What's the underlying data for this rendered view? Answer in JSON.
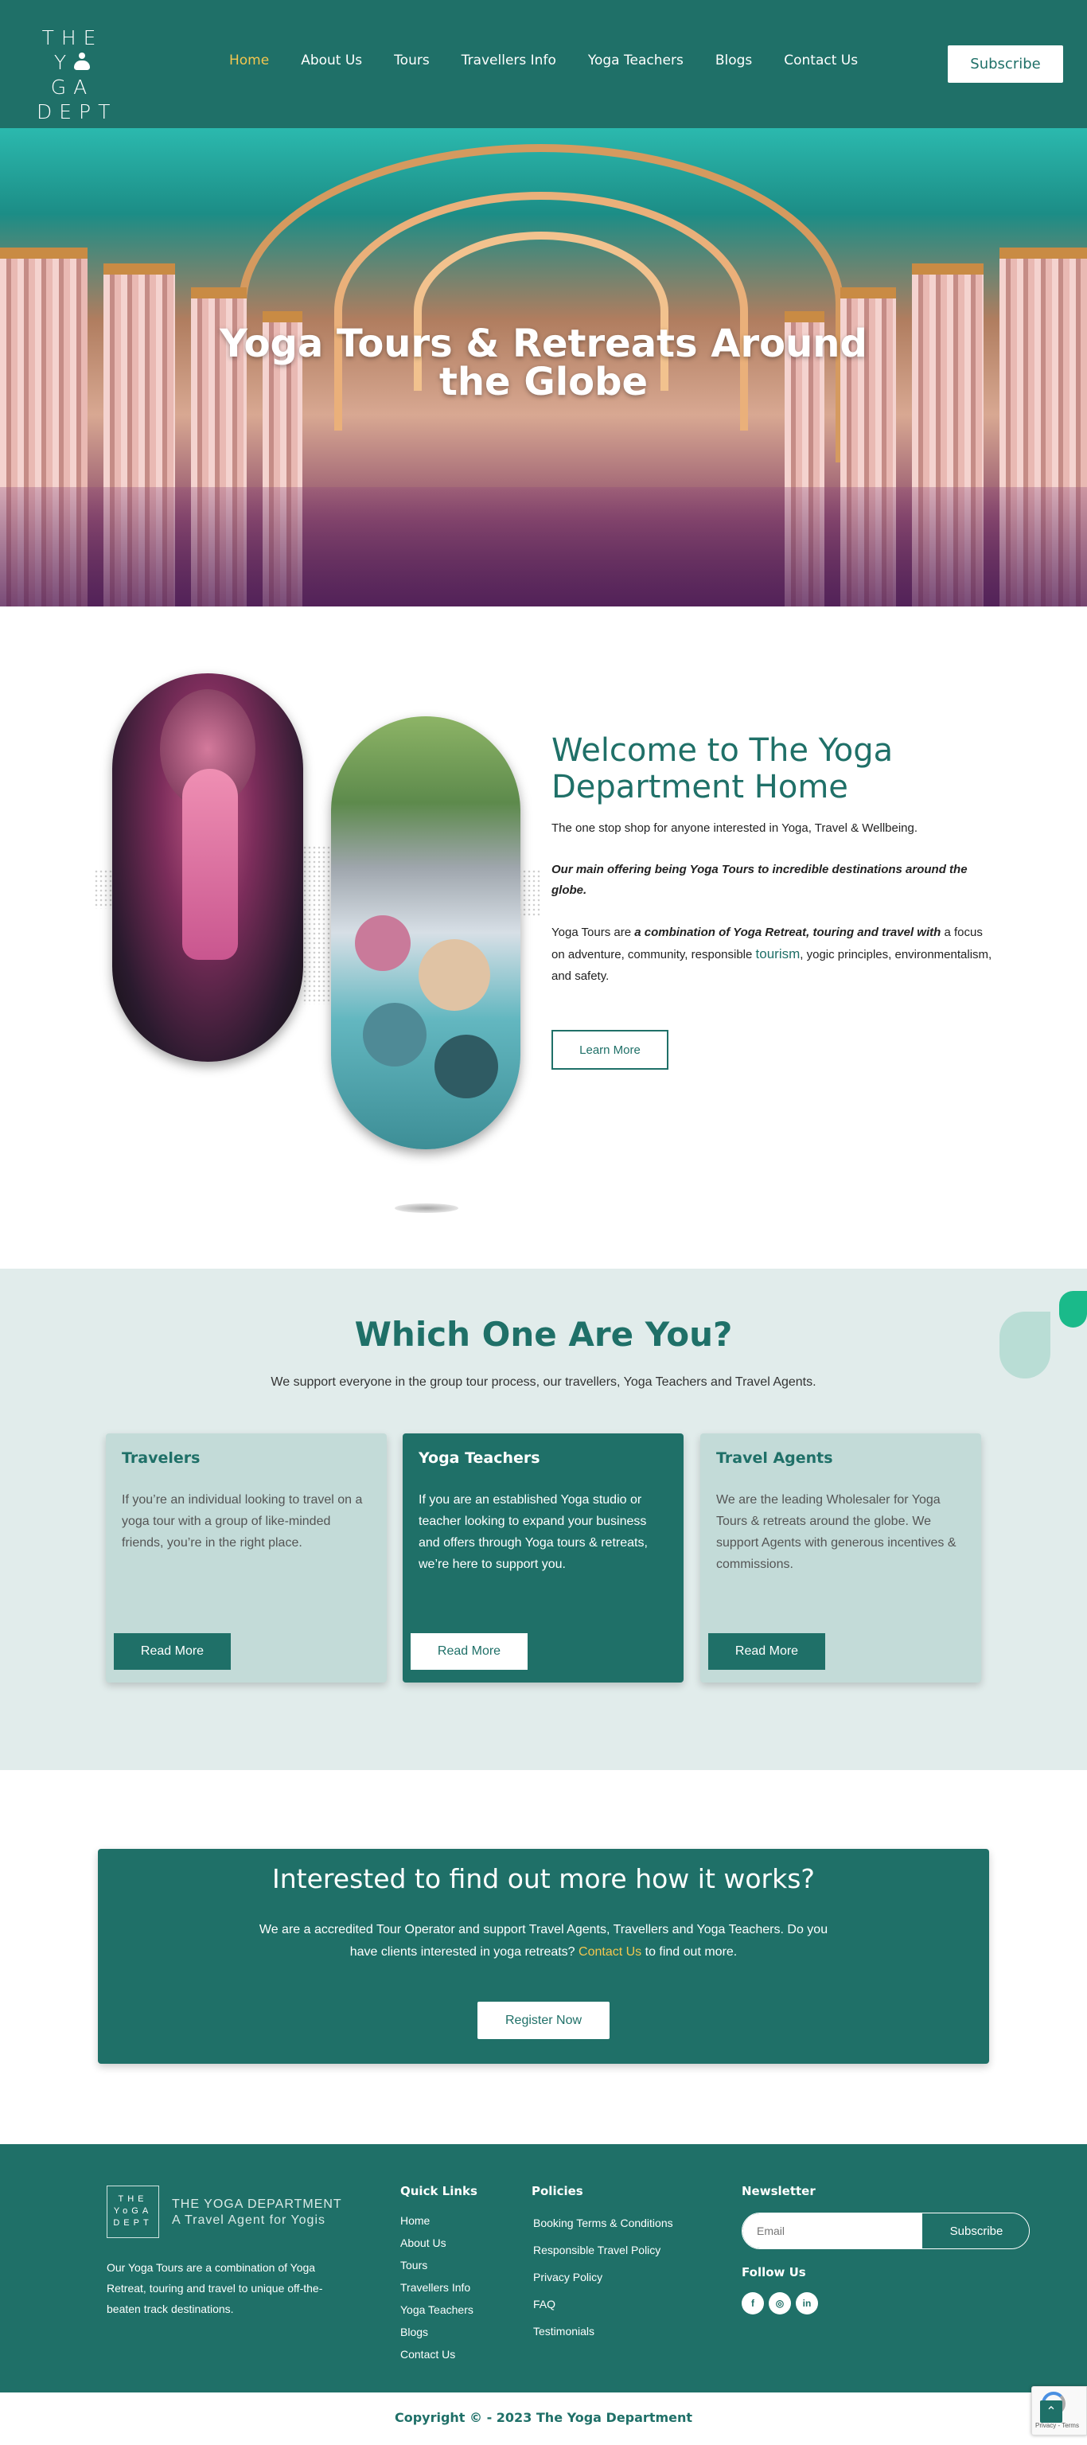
{
  "header": {
    "logo": {
      "line1": "THE",
      "line2a": "Y",
      "line2b": "GA",
      "line3": "DEPT"
    },
    "nav": [
      "Home",
      "About Us",
      "Tours",
      "Travellers Info",
      "Yoga Teachers",
      "Blogs",
      "Contact Us"
    ],
    "active_nav": "Home",
    "subscribe_label": "Subscribe"
  },
  "hero": {
    "title": "Yoga Tours & Retreats Around the Globe"
  },
  "welcome": {
    "title": "Welcome to The Yoga Department Home",
    "para1": "The one stop shop for anyone interested in Yoga, Travel & Wellbeing.",
    "para2": "Our main offering being Yoga Tours to incredible destinations around the globe.",
    "para3_a": "Yoga Tours are ",
    "para3_b": "a combination of Yoga Retreat, touring and travel with",
    "para3_c": " a focus on adventure, community, responsible ",
    "para3_link": "tourism",
    "para3_d": ", yogic principles, environmentalism, and safety.",
    "learn_more": "Learn More"
  },
  "which": {
    "title": "Which One Are You?",
    "subtitle": "We support everyone in the group tour process, our travellers, Yoga Teachers and Travel Agents.",
    "cards": [
      {
        "title": "Travelers",
        "text": "If you’re an individual looking to travel on a yoga tour with a group of like-minded friends, you’re in the right place.",
        "button": "Read More"
      },
      {
        "title": "Yoga Teachers",
        "text": "If you are an established Yoga studio or teacher looking to expand your business and offers through Yoga tours & retreats, we’re here to support you.",
        "button": "Read More"
      },
      {
        "title": "Travel Agents",
        "text": "We are the leading Wholesaler for Yoga Tours & retreats around the globe. We support Agents with generous incentives & commissions.",
        "button": "Read More"
      }
    ]
  },
  "cta": {
    "title": "Interested to find out more how it works?",
    "text_a": "We are a accredited Tour Operator and support Travel Agents, Travellers and Yoga Teachers. Do you have clients interested in yoga retreats?  ",
    "text_link": "Contact Us",
    "text_b": " to find out more.",
    "button": "Register Now"
  },
  "footer": {
    "brand_line1": "THE YOGA DEPARTMENT",
    "brand_line2": "A Travel Agent for Yogis",
    "description": "Our Yoga Tours are a combination of Yoga Retreat, touring and travel to unique off-the-beaten track destinations.",
    "quick_links_title": "Quick Links",
    "quick_links": [
      "Home",
      "About Us",
      "Tours",
      "Travellers Info",
      "Yoga Teachers",
      "Blogs",
      "Contact Us"
    ],
    "policies_title": "Policies",
    "policies": [
      "Booking Terms & Conditions",
      "Responsible Travel Policy",
      "Privacy Policy",
      "FAQ",
      "Testimonials"
    ],
    "newsletter_title": "Newsletter",
    "email_placeholder": "Email",
    "subscribe_label": "Subscribe",
    "follow_title": "Follow Us",
    "social_icons": [
      "facebook-icon",
      "instagram-icon",
      "linkedin-icon"
    ],
    "copyright": "Copyright © - 2023 The Yoga Department"
  },
  "recaptcha": {
    "text": "Privacy - Terms"
  },
  "colors": {
    "brand": "#1f7068",
    "accent": "#f3c64f",
    "light_bg": "#e1eceb",
    "card_light": "#c3dbd8"
  }
}
